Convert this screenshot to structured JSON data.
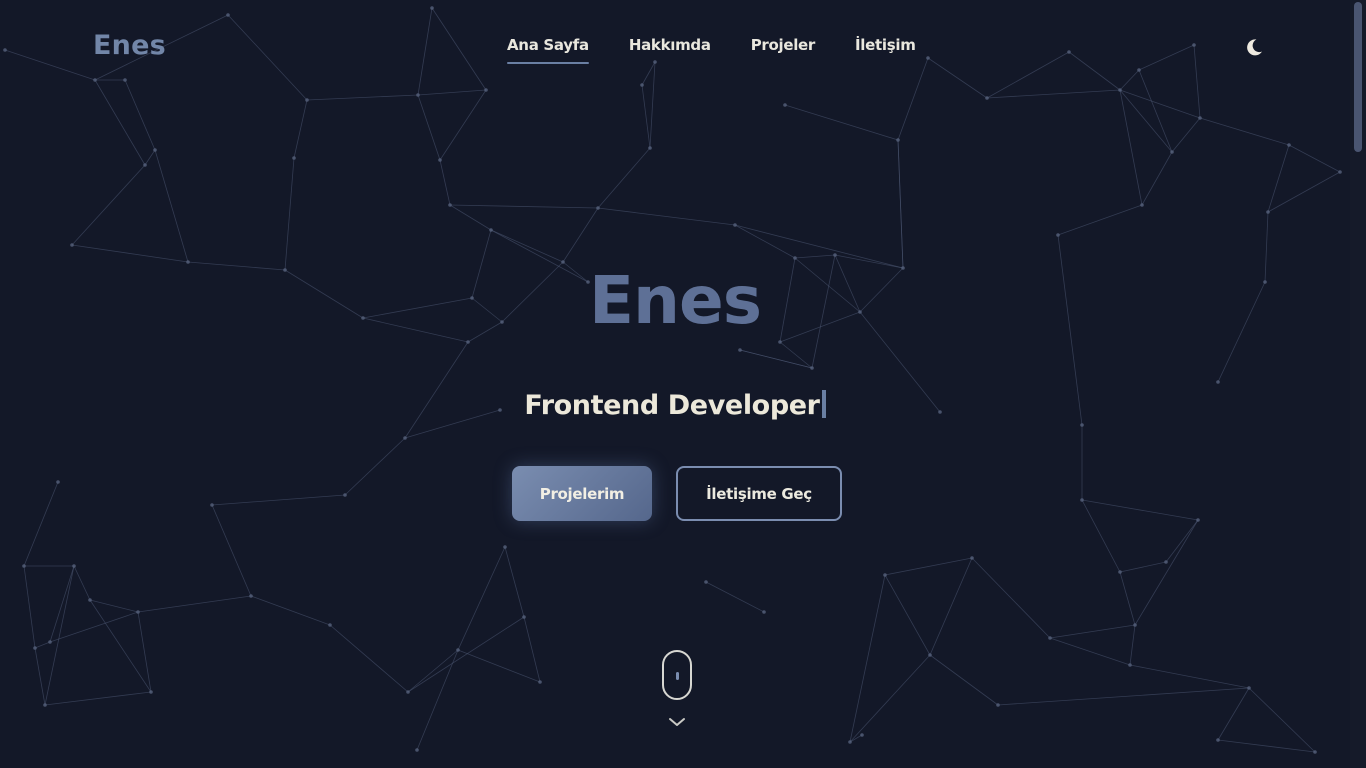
{
  "brand": {
    "logo_text": "Enes"
  },
  "nav": {
    "items": [
      {
        "label": "Ana Sayfa",
        "active": true
      },
      {
        "label": "Hakkımda",
        "active": false
      },
      {
        "label": "Projeler",
        "active": false
      },
      {
        "label": "İletişim",
        "active": false
      }
    ],
    "theme_toggle_icon": "moon-icon"
  },
  "hero": {
    "title": "Enes",
    "subtitle": "Frontend Developer",
    "primary_button": "Projelerim",
    "secondary_button": "İletişime Geç"
  },
  "scroll_indicator": {
    "icons": [
      "mouse-icon",
      "chevron-down-icon"
    ]
  },
  "colors": {
    "background": "#131828",
    "accent": "#6a7fa3",
    "title": "#5e7096",
    "text": "#ece8da",
    "network_lines": "#4e5a74"
  }
}
